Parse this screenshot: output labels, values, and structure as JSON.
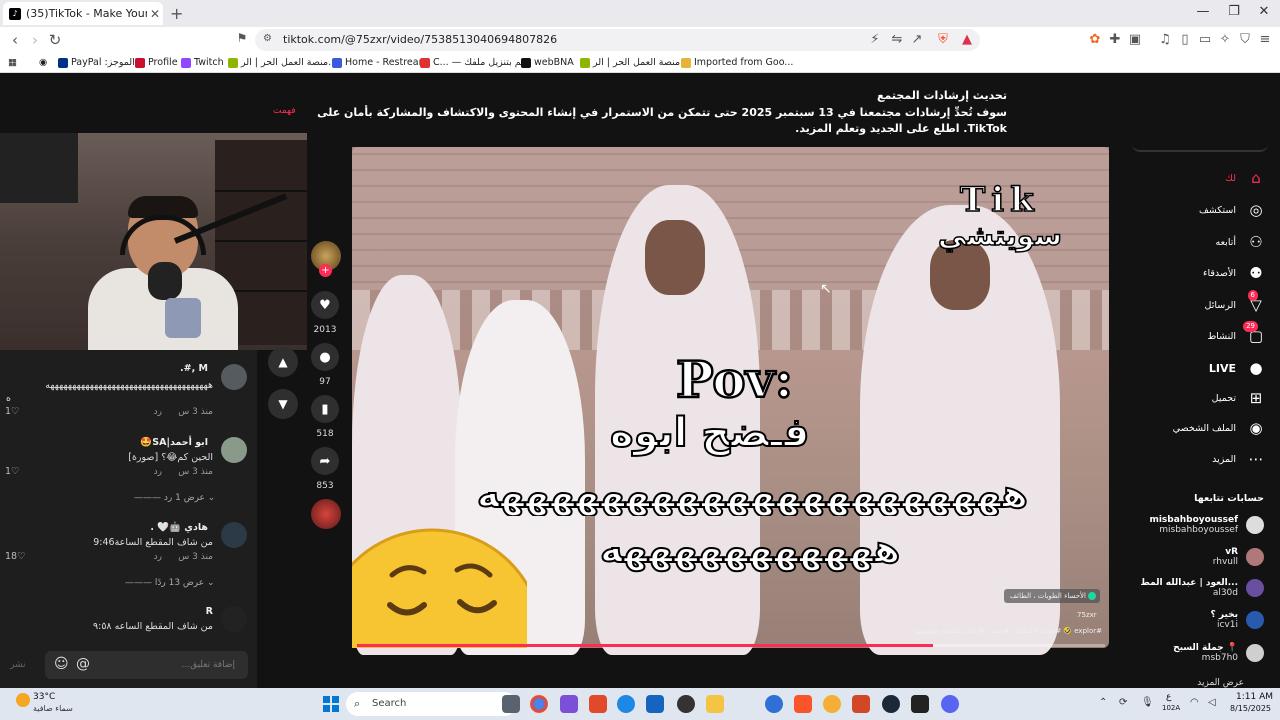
{
  "browser": {
    "tab_title": "(35)TikTok - Make Your Day",
    "tab_close": "✕",
    "new_tab": "+",
    "url": "tiktok.com/@75zxr/video/7538513040694807826",
    "bookmarks": [
      {
        "label": "PayPal :الموجز",
        "color": "#003087"
      },
      {
        "label": "Profile",
        "color": "#c8102e"
      },
      {
        "label": "Twitch",
        "color": "#9146ff"
      },
      {
        "label": "منصة العمل الحر | الر...",
        "color": "#8db600"
      },
      {
        "label": "Home - Restream",
        "color": "#3b5bdb"
      },
      {
        "label": "C... — قم بتنزيل ملفك",
        "color": "#e03131"
      },
      {
        "label": "webBNA",
        "color": "#111111"
      },
      {
        "label": "منصة العمل الحر | الر...",
        "color": "#8db600"
      },
      {
        "label": "Imported from Goo...",
        "color": "#e8b339"
      }
    ]
  },
  "notice": {
    "title": "تحديث إرشادات المجتمع",
    "body": "سوف تُحدِّ إرشادات مجتمعنا في 13 سبتمبر 2025 حتى تتمكن من الاستمرار في إنشاء المحتوى والاكتشاف والمشاركة بأمان على TikTok. اطلع على الجديد وتعلم المزيد.",
    "dismiss": "فهمت"
  },
  "comments": {
    "items": [
      {
        "name": "M ,#.",
        "text": "هههههههههههههههههههههههههههههههههههههه",
        "text2": "ه",
        "time": "منذ 3 س",
        "reply": "رد",
        "likes": "1",
        "avatar_color": "#555b5e"
      },
      {
        "name": "ابو أحمد|SA🤩",
        "text": "الحين كم😂؟ [صورة]",
        "time": "منذ 3 س",
        "reply": "رد",
        "likes": "1",
        "avatar_color": "#8a9a8a",
        "more": "عرض 1 رد"
      },
      {
        "name": "هادي 🤖🤍 .",
        "text": "من شاف المقطع الساعة9:46",
        "time": "منذ 3 س",
        "reply": "رد",
        "likes": "18",
        "avatar_color": "#2c3a48",
        "more": "عرض 13 ردًا"
      },
      {
        "name": "R",
        "text": "من شاف المقطع الساعه ٩:٥٨",
        "avatar_color": "#222222"
      }
    ],
    "input_placeholder": "إضافة تعليق...",
    "post": "نشر",
    "emoji": "☺",
    "mention": "@"
  },
  "rail": {
    "likes": "2013",
    "comments": "97",
    "saves": "518",
    "shares": "853"
  },
  "video": {
    "text_tik": "Tik",
    "text_switch": "سويتشي",
    "text_pov": "Pov:",
    "text_line2": "فـضح ابوه",
    "text_line3": "هههههههههههههههههههههه",
    "text_line4": "هههههههههههه",
    "location": "الأحساء الطوبات ، الطائف",
    "username": "75zxr",
    "caption": "#explor 🤣 #قعدة #الطائف #شعب 😂 الله يسامحه ههههههههه",
    "progress": 0.77
  },
  "rightnav": {
    "items": [
      {
        "label": "لك",
        "icon": "⌂",
        "icon_name": "home-icon",
        "active": true
      },
      {
        "label": "استكشف",
        "icon": "◎",
        "icon_name": "compass-icon"
      },
      {
        "label": "أتابعه",
        "icon": "⚇",
        "icon_name": "user-follow-icon"
      },
      {
        "label": "الأصدقاء",
        "icon": "⚉",
        "icon_name": "friends-icon"
      },
      {
        "label": "الرسائل",
        "icon": "▽",
        "icon_name": "messages-icon",
        "badge": "6"
      },
      {
        "label": "النشاط",
        "icon": "▢",
        "icon_name": "activity-icon",
        "badge": "29"
      },
      {
        "label": "LIVE",
        "icon": "●",
        "icon_name": "live-icon"
      },
      {
        "label": "تحميل",
        "icon": "⊞",
        "icon_name": "upload-icon"
      },
      {
        "label": "الملف الشخصي",
        "icon": "◉",
        "icon_name": "profile-icon"
      },
      {
        "label": "المزيد",
        "icon": "⋯",
        "icon_name": "more-icon"
      }
    ],
    "following_title": "حسابات تتابعها",
    "following": [
      {
        "name": "misbahboyoussef",
        "user": "misbahboyoussef",
        "color": "#dddddd"
      },
      {
        "name": "vR",
        "user": "rhvull",
        "color": "#b07878"
      },
      {
        "name": "العود | عبدالله المط...",
        "user": "al30d",
        "color": "#6a4fa0"
      },
      {
        "name": "بخير ؟",
        "user": "icv1i",
        "color": "#2a5ab0"
      },
      {
        "name": "جملة السبح 📍",
        "user": "msb7h0",
        "color": "#cfcfcf"
      }
    ],
    "see_more": "عرض المزيد"
  },
  "taskbar": {
    "temp": "33°C",
    "weather": "سماء صافية",
    "search": "Search",
    "time": "1:11 AM",
    "date": "8/15/2025",
    "lang": "ع",
    "lang_sub": "102A"
  }
}
